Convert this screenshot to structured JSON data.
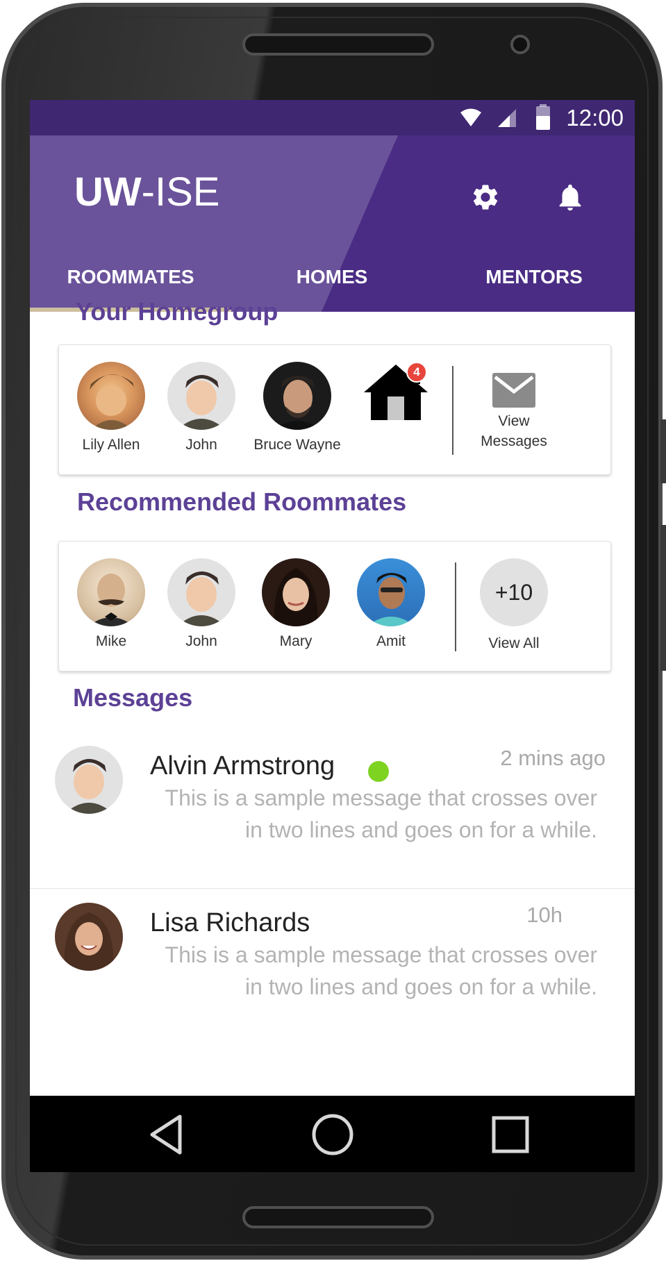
{
  "status_bar": {
    "time": "12:00",
    "icons": [
      "wifi-icon",
      "signal-icon",
      "battery-icon"
    ]
  },
  "app_bar": {
    "title_bold": "UW",
    "title_rest": "-ISE",
    "actions": [
      "settings-icon",
      "notifications-bell-icon"
    ],
    "tabs": [
      {
        "label": "ROOMMATES",
        "selected": true
      },
      {
        "label": "HOMES",
        "selected": false
      },
      {
        "label": "MENTORS",
        "selected": false
      }
    ]
  },
  "homegroup": {
    "title": "Your Homegroup",
    "members": [
      {
        "name": "Lily Allen"
      },
      {
        "name": "John"
      },
      {
        "name": "Bruce Wayne"
      }
    ],
    "home_badge": "4",
    "view_messages_line1": "View",
    "view_messages_line2": "Messages"
  },
  "recommended": {
    "title": "Recommended Roommates",
    "people": [
      {
        "name": "Mike"
      },
      {
        "name": "John"
      },
      {
        "name": "Mary"
      },
      {
        "name": "Amit"
      }
    ],
    "more_count": "+10",
    "view_all": "View All"
  },
  "messages": {
    "title": "Messages",
    "items": [
      {
        "name": "Alvin Armstrong",
        "time": "2 mins ago",
        "text": "This is a sample message that crosses over in two lines and goes on for a while.",
        "online": true
      },
      {
        "name": "Lisa Richards",
        "time": "10h",
        "text": "This is a sample message that crosses over in two lines and goes on for a while.",
        "online": false
      }
    ]
  },
  "colors": {
    "primary": "#4a2c84",
    "status_bar": "#3f2772",
    "section_title": "#5c4196",
    "tab_indicator": "#cdbf9e",
    "online": "#7ed321",
    "badge": "#e8453c"
  },
  "nav_bar": {
    "buttons": [
      "back-icon",
      "home-icon",
      "recents-icon"
    ]
  }
}
